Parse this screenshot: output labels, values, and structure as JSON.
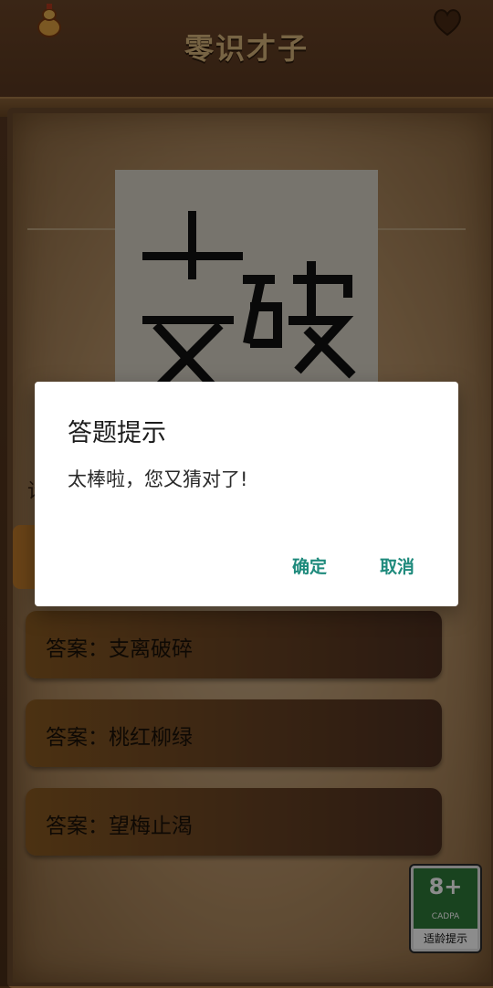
{
  "header": {
    "title": "零识才子",
    "left_icon": "gourd-icon",
    "right_icon": "heart-icon"
  },
  "puzzle": {
    "image_description_icon": "puzzle-image"
  },
  "side_label": "请",
  "answers": [
    {
      "label": "答案：支离破碎"
    },
    {
      "label": "答案：桃红柳绿"
    },
    {
      "label": "答案：望梅止渴"
    }
  ],
  "age_rating": {
    "number": "8+",
    "org": "CADPA",
    "footer": "适龄提示"
  },
  "dialog": {
    "title": "答题提示",
    "message": "太棒啦，您又猜对了!",
    "ok_label": "确定",
    "cancel_label": "取消",
    "button_color": "#1e8a7c"
  }
}
